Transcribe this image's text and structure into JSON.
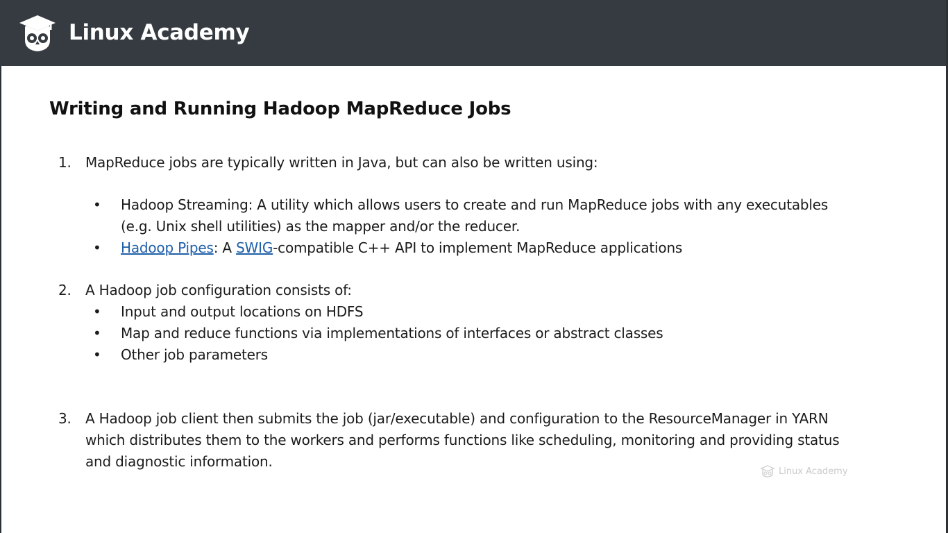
{
  "header": {
    "brand": "Linux Academy",
    "logo_icon": "owl-graduation-cap-icon",
    "background": "#353b40"
  },
  "slide": {
    "title": "Writing and Running Hadoop MapReduce Jobs",
    "items": [
      {
        "number": "1.",
        "text": "MapReduce jobs are typically written in Java, but can also be written using:",
        "bullets": [
          {
            "text": "Hadoop Streaming: A utility which allows users to create and run MapReduce jobs with any executables (e.g. Unix shell utilities) as the mapper and/or the reducer."
          },
          {
            "link1": "Hadoop Pipes",
            "sep": ": A ",
            "link2": "SWIG",
            "rest": "-compatible C++ API to implement MapReduce applications"
          }
        ]
      },
      {
        "number": "2.",
        "text": "A Hadoop job configuration consists of:",
        "bullets": [
          {
            "text": "Input and output locations on HDFS"
          },
          {
            "text": "Map and reduce functions via implementations of interfaces or abstract classes"
          },
          {
            "text": "Other job parameters"
          }
        ]
      },
      {
        "number": "3.",
        "text": "A Hadoop job client then submits the job (jar/executable) and configuration to the ResourceManager in YARN which distributes them to the workers and performs functions like scheduling, monitoring and providing status and diagnostic information."
      }
    ],
    "bullet_symbol": "•",
    "link_color": "#1f5fa8"
  },
  "watermark": {
    "text": "Linux Academy",
    "icon": "owl-icon"
  }
}
